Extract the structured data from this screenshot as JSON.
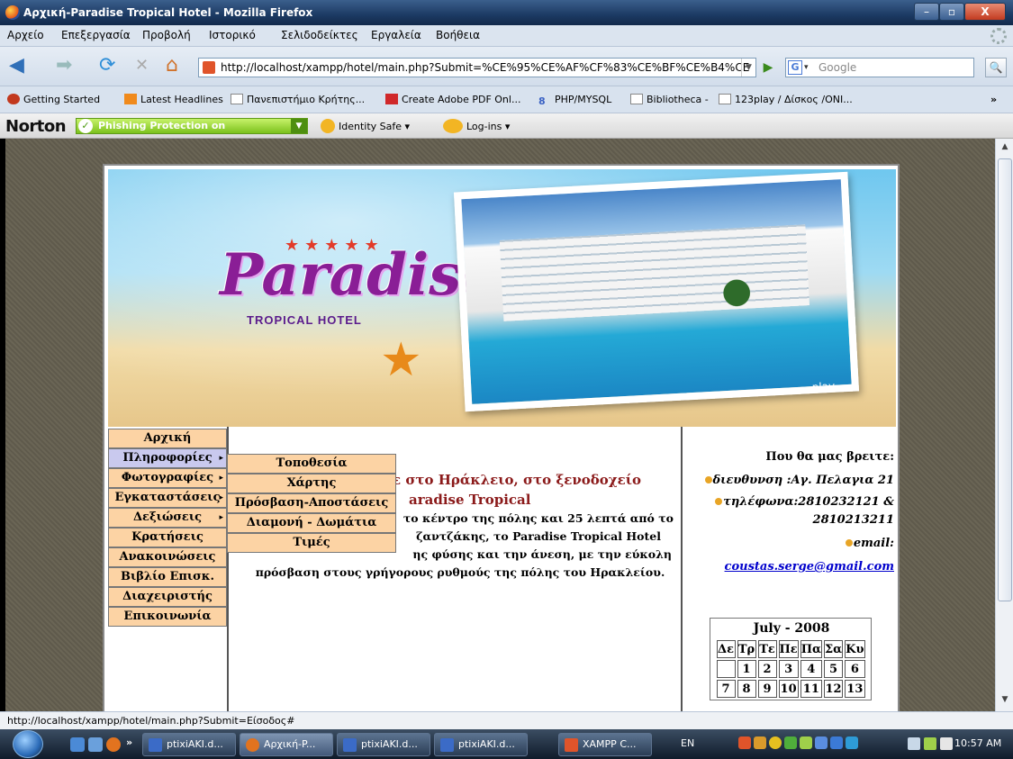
{
  "window": {
    "title": "Αρχική-Paradise Tropical Hotel - Mozilla Firefox",
    "min": "–",
    "max": "▫",
    "close": "X"
  },
  "menubar": [
    "Αρχείο",
    "Επεξεργασία",
    "Προβολή",
    "Ιστορικό",
    "Σελιδοδείκτες",
    "Εργαλεία",
    "Βοήθεια"
  ],
  "nav": {
    "back": "◀",
    "forward": "➡",
    "reload": "⟳",
    "stop": "✕",
    "home": "⌂",
    "url": "http://localhost/xampp/hotel/main.php?Submit=%CE%95%CE%AF%CF%83%CE%BF%CE%B4%CE",
    "search_placeholder": "Google",
    "search_logo": "G",
    "go": "▶",
    "search_btn": "🔍"
  },
  "bookmarks": [
    "Getting Started",
    "Latest Headlines",
    "Πανεπιστήμιο Κρήτης...",
    "Create Adobe PDF Onl...",
    "PHP/MYSQL",
    "Bibliotheca -",
    "123play / Δίσκος /ONI...",
    "»"
  ],
  "norton": {
    "logo": "Norton",
    "phishing": "Phishing Protection on",
    "identity": "Identity Safe ▾",
    "logins": "Log-ins ▾",
    "check": "✓"
  },
  "banner": {
    "logo": "Paradise",
    "subtitle": "TROPICAL HOTEL",
    "stars": "★★★★★",
    "caption": "play"
  },
  "menu": [
    {
      "label": "Αρχική",
      "sub": ""
    },
    {
      "label": "Πληροφορίες",
      "sub": "▸"
    },
    {
      "label": "Φωτογραφίες",
      "sub": "▸"
    },
    {
      "label": "Εγκαταστάσεις",
      "sub": "▸"
    },
    {
      "label": "Δεξιώσεις",
      "sub": "▸"
    },
    {
      "label": "Κρατήσεις",
      "sub": ""
    },
    {
      "label": "Ανακοινώσεις",
      "sub": ""
    },
    {
      "label": "Βιβλίο Επισκ.",
      "sub": ""
    },
    {
      "label": "Διαχειριστής",
      "sub": ""
    },
    {
      "label": "Επικοινωνία",
      "sub": ""
    }
  ],
  "submenu": [
    "Τοποθεσία",
    "Χάρτης",
    "Πρόσβαση-Αποστάσεις",
    "Διαμονή - Δωμάτια",
    "Τιμές"
  ],
  "content": {
    "welcome_1": "ε στο Ηράκλειο, στο ξενοδοχείο",
    "welcome_2": "aradise Tropical",
    "desc_1": "το κέντρο της πόλης και 25 λεπτά από το",
    "desc_2": "ζαντζάκης, το Paradise Tropical Hotel",
    "desc_3": "ης φύσης και την άνεση, με την εύκολη",
    "desc_4": "πρόσβαση στους γρήγορους ρυθμούς της πόλης του Ηρακλείου."
  },
  "contact": {
    "title": "Που θα μας βρειτε:",
    "address": "διευθυνση :Αγ. Πελαγια 21",
    "phone_1": "τηλέφωνα:2810232121 &",
    "phone_2": "2810213211",
    "email_label": "email:",
    "email": "coustas.serge@gmail.com"
  },
  "calendar": {
    "title": "July - 2008",
    "days": [
      "Δε",
      "Τρ",
      "Τε",
      "Πε",
      "Πα",
      "Σα",
      "Κυ"
    ],
    "row1": [
      "",
      "1",
      "2",
      "3",
      "4",
      "5",
      "6"
    ],
    "row2": [
      "7",
      "8",
      "9",
      "10",
      "11",
      "12",
      "13"
    ]
  },
  "status": "http://localhost/xampp/hotel/main.php?Submit=Είσοδος#",
  "taskbar": {
    "tasks": [
      "ptixiAKI.d...",
      "Αρχική-P...",
      "ptixiAKI.d...",
      "ptixiAKI.d...",
      "XAMPP C..."
    ],
    "lang": "EN",
    "chevron": "»",
    "clock": "10:57 AM"
  }
}
